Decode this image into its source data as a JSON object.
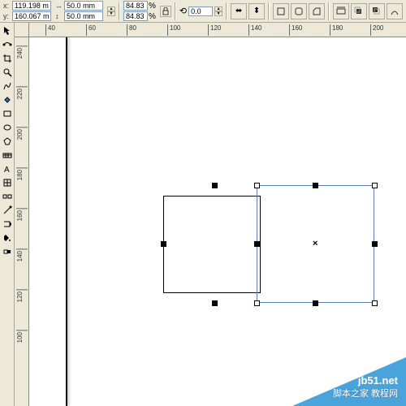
{
  "propertyBar": {
    "xLabel": "x:",
    "yLabel": "y:",
    "xValue": "119.198 mm",
    "yValue": "160.067 mm",
    "widthIcon": "↔",
    "heightIcon": "↕",
    "widthValue": "50.0 mm",
    "heightValue": "50.0 mm",
    "scaleX": "84.83",
    "scaleY": "84.83",
    "scaleUnit": "%",
    "rotationIcon": "⟲",
    "rotationValue": "0.0",
    "skewIcon": "⟋"
  },
  "rulerH": [
    "40",
    "60",
    "80",
    "100",
    "120",
    "140",
    "160",
    "180",
    "200"
  ],
  "rulerV": [
    "240",
    "220",
    "200",
    "180",
    "160",
    "140",
    "120",
    "100"
  ],
  "tools": [
    "pick-tool",
    "shape-tool",
    "crop-tool",
    "zoom-tool",
    "freehand-tool",
    "smart-fill-tool",
    "rectangle-tool",
    "ellipse-tool",
    "polygon-tool",
    "basic-shapes-tool",
    "text-tool",
    "table-tool",
    "blend-tool",
    "eyedropper-tool",
    "outline-tool",
    "fill-tool",
    "interactive-fill-tool"
  ],
  "watermark": {
    "site": "jb51.net",
    "sub": "脚本之家 教程网"
  }
}
